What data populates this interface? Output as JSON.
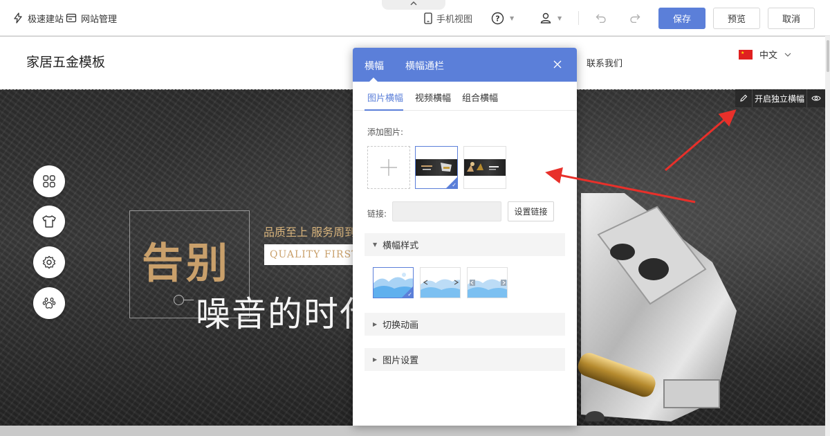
{
  "toolbar": {
    "quick_build": "极速建站",
    "site_manage": "网站管理",
    "mobile_view": "手机视图",
    "save": "保存",
    "preview": "预览",
    "cancel": "取消",
    "accent": "#5b7fd9"
  },
  "site": {
    "title": "家居五金模板",
    "nav_contact": "联系我们",
    "language": "中文"
  },
  "banner": {
    "headline_big": "告别",
    "slogan": "品质至上 服务周到",
    "quality_first": "QUALITY FIRST",
    "headline_white": "噪音的时代",
    "independent_banner_button": "开启独立横幅"
  },
  "modal": {
    "tabs": [
      "横幅",
      "横幅通栏"
    ],
    "sub_tabs": [
      "图片横幅",
      "视频横幅",
      "组合横幅"
    ],
    "add_image_label": "添加图片:",
    "link_label": "链接:",
    "link_value": "",
    "set_link_button": "设置链接",
    "sections": {
      "banner_style": "横幅样式",
      "switch_animation": "切换动画",
      "image_settings": "图片设置"
    }
  }
}
